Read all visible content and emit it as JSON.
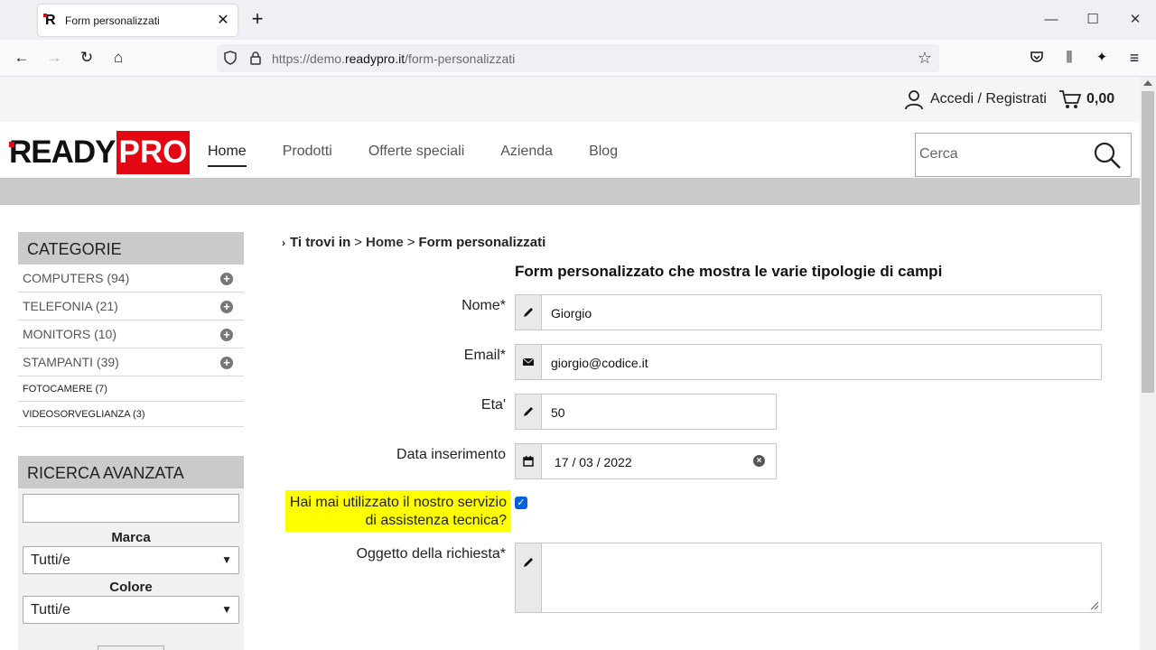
{
  "browser": {
    "tab_title": "Form personalizzati",
    "tab_close": "✕",
    "new_tab": "+",
    "window_controls": {
      "minimize": "—",
      "maximize": "☐",
      "close": "✕"
    },
    "nav": {
      "back": "←",
      "forward": "→",
      "reload": "↻",
      "home": "⌂"
    },
    "url_prefix": "https://demo.",
    "url_domain": "readypro.it",
    "url_path": "/form-personalizzati",
    "bookmark": "☆",
    "toolbar": {
      "pocket": "◡",
      "library": "⫼",
      "extensions": "✦",
      "menu": "≡"
    }
  },
  "topbar": {
    "login_label": "Accedi / Registrati",
    "cart_total": "0,00"
  },
  "header": {
    "logo_ready": "READY",
    "logo_pro": "PRO",
    "menu": [
      {
        "label": "Home",
        "active": true
      },
      {
        "label": "Prodotti"
      },
      {
        "label": "Offerte speciali"
      },
      {
        "label": "Azienda"
      },
      {
        "label": "Blog"
      }
    ],
    "search_placeholder": "Cerca"
  },
  "sidebar": {
    "categories_title": "CATEGORIE",
    "categories": [
      {
        "label": "COMPUTERS (94)",
        "expandable": true
      },
      {
        "label": "TELEFONIA (21)",
        "expandable": true
      },
      {
        "label": "MONITORS (10)",
        "expandable": true
      },
      {
        "label": "STAMPANTI (39)",
        "expandable": true
      },
      {
        "label": "FOTOCAMERE (7)",
        "expandable": false
      },
      {
        "label": "VIDEOSORVEGLIANZA (3)",
        "expandable": false
      }
    ],
    "advanced_title": "RICERCA AVANZATA",
    "brand_label": "Marca",
    "brand_value": "Tutti/e",
    "color_label": "Colore",
    "color_value": "Tutti/e"
  },
  "breadcrumb": {
    "prefix": "Ti trovi in",
    "sep": ">",
    "home": "Home",
    "current": "Form personalizzati"
  },
  "form": {
    "title": "Form personalizzato che mostra le varie tipologie di campi",
    "name_label": "Nome*",
    "name_value": "Giorgio",
    "email_label": "Email*",
    "email_value": "giorgio@codice.it",
    "age_label": "Eta'",
    "age_value": "50",
    "date_label": "Data inserimento",
    "date_value": "17 / 03 / 2022",
    "service_label": "Hai mai utilizzato il nostro servizio di assistenza tecnica?",
    "service_checked": true,
    "subject_label": "Oggetto della richiesta*",
    "subject_value": ""
  },
  "colors": {
    "brand_red": "#e30613",
    "highlight": "#ffff00",
    "checkbox": "#0060df",
    "sidebar_head": "#cacaca"
  }
}
